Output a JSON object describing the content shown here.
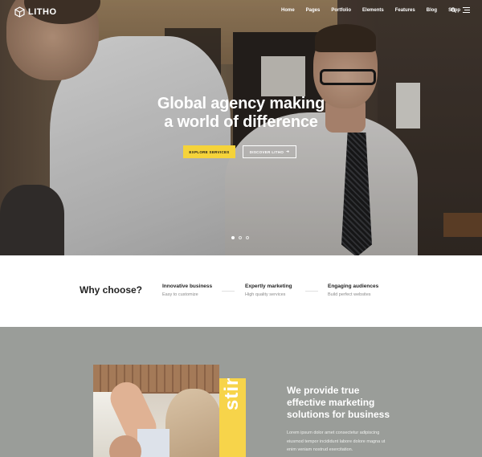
{
  "nav": {
    "logo_text": "LITHO",
    "items": [
      "Home",
      "Pages",
      "Portfolio",
      "Elements",
      "Features",
      "Blog",
      "Shop"
    ],
    "icons": [
      "search-icon",
      "menu-icon"
    ]
  },
  "hero": {
    "headline_part1": "Global ",
    "headline_bold": "agency making",
    "headline_line2": "a world of difference",
    "btn_primary": "EXPLORE SERVICES",
    "btn_secondary": "DISCOVER LITHO",
    "slides": 3,
    "active_slide": 1,
    "accent_color": "#f5d33a"
  },
  "why": {
    "title": "Why choose?",
    "features": [
      {
        "title": "Innovative business",
        "subtitle": "Easy to customize"
      },
      {
        "title": "Expertly marketing",
        "subtitle": "High quality services"
      },
      {
        "title": "Engaging audiences",
        "subtitle": "Build perfect websites"
      }
    ]
  },
  "about": {
    "vertical_word": "sting",
    "heading_line1": "We provide true",
    "heading_line2": "effective marketing",
    "heading_bold": "solutions",
    "heading_rest": " for business",
    "body": "Lorem ipsum dolor amet consectetur adipiscing eiusmod tempor incididunt labore dolore magna ut enim veniam nostrud exercitation."
  }
}
